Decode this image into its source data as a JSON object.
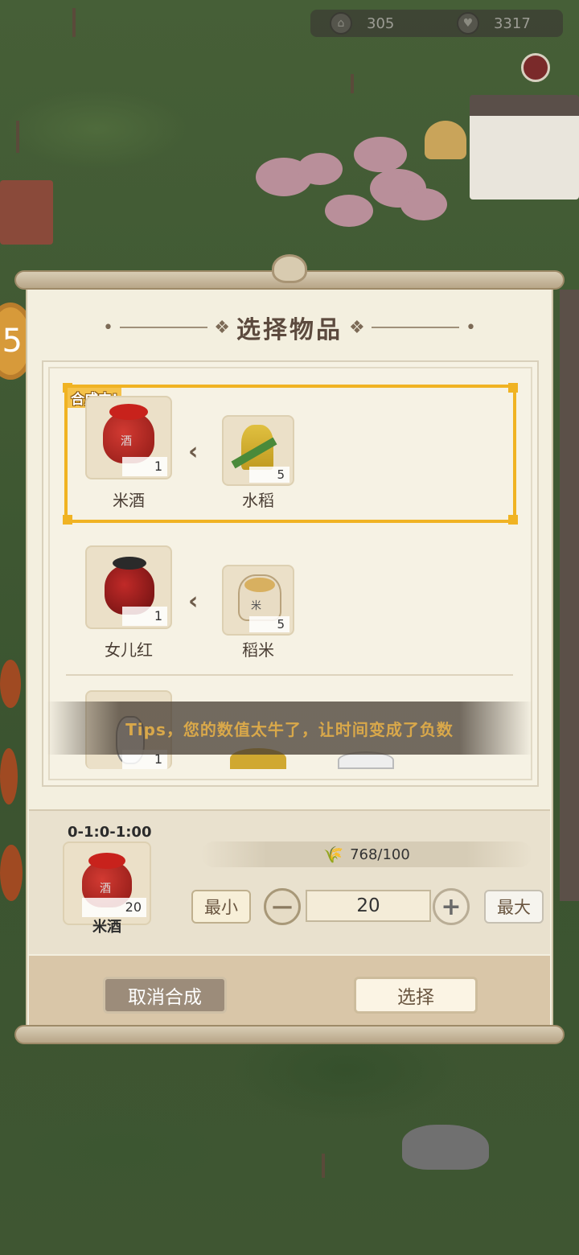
{
  "resources": {
    "res1": "305",
    "res2": "3317"
  },
  "panel": {
    "title": "选择物品",
    "side_badge": "5"
  },
  "recipes": [
    {
      "status_badge": "合成中!",
      "output_name": "米酒",
      "output_count": "1",
      "input_name": "水稻",
      "input_count": "5",
      "output_label": "酒"
    },
    {
      "output_name": "女儿红",
      "output_count": "1",
      "input_name": "稻米",
      "input_count": "5",
      "input_label": "米"
    },
    {
      "output_count": "1"
    }
  ],
  "toast": "Tips，您的数值太牛了，让时间变成了负数",
  "craft": {
    "time": "0-1:0-1:00",
    "item_name": "米酒",
    "item_count": "20",
    "item_label": "酒",
    "requirement": "768/100",
    "min_label": "最小",
    "max_label": "最大",
    "quantity": "20",
    "minus_symbol": "—",
    "plus_symbol": "+"
  },
  "actions": {
    "cancel": "取消合成",
    "choose": "选择"
  },
  "colors": {
    "highlight": "#f0b323",
    "paper": "#f3efdf",
    "title": "#5c4a3e",
    "toast_text": "#d9a84a"
  },
  "icons": {
    "res1": "house-icon",
    "res2": "heart-icon",
    "arrow": "chevron-left-icon",
    "rice": "rice-stalk-icon"
  }
}
